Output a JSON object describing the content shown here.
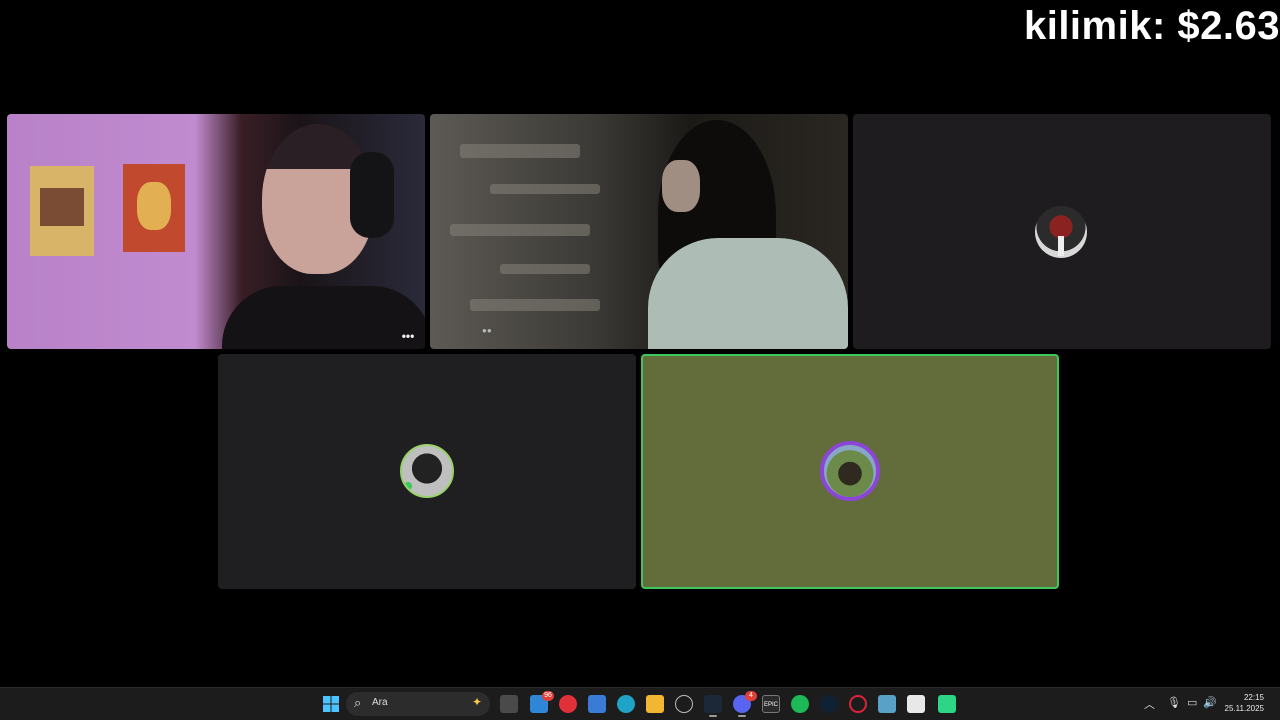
{
  "overlay": {
    "title": "kilimik: $2.63"
  },
  "tiles": {
    "more_label": "•••"
  },
  "taskbar": {
    "search_placeholder": "Ara",
    "search_icon": "search-icon",
    "mail_badge": "96",
    "discord_badge": "4",
    "icons": [
      "windows-start-icon",
      "search-icon",
      "task-view-icon",
      "mail-icon",
      "opera-gx-icon",
      "store-icon",
      "edge-icon",
      "file-explorer-icon",
      "clock-app-icon",
      "steam-icon",
      "discord-icon",
      "epic-games-icon",
      "spotify-icon",
      "app-icon",
      "opera-icon",
      "network-app-icon",
      "snipping-tool-icon",
      "game-icon"
    ]
  },
  "tray": {
    "time": "22:15",
    "date": "25.11.2025",
    "icons": [
      "chevron-up-icon",
      "microphone-icon",
      "network-icon",
      "volume-icon"
    ]
  },
  "colors": {
    "active_speaker_border": "#3ec75a",
    "active_tile_bg": "#636c3b",
    "tile_bg": "#1f1e21"
  }
}
